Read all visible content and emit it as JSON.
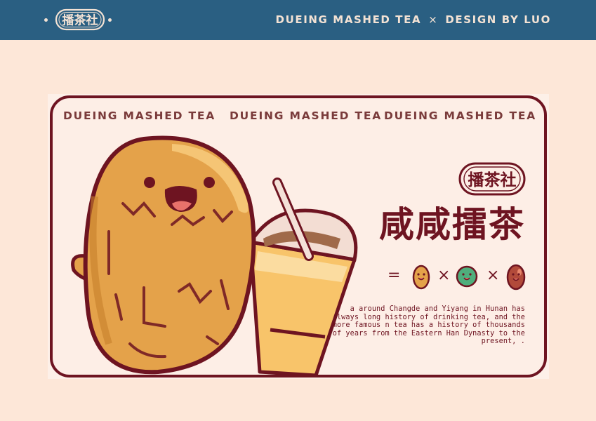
{
  "header": {
    "seal_text": "播茶社",
    "title_left": "DUEING MASHED TEA",
    "separator": "×",
    "title_right": "DESIGN BY LUO"
  },
  "card": {
    "marquee": [
      "DUEING MASHED TEA",
      "DUEING MASHED TEA",
      "DUEING MASHED TEA"
    ],
    "seal_text": "播茶社",
    "headline": "咸咸擂茶",
    "formula": {
      "equals": "=",
      "times": "×"
    },
    "description": "a around Changde and Yiyang in Hunan has always long history of drinking tea, and the more famous n tea has a history of thousands of years from the Eastern Han Dynasty to the present, ."
  },
  "colors": {
    "topbar": "#2a5f82",
    "page": "#fde7d8",
    "maroon": "#6e1421",
    "peanut": "#e4a24a",
    "cup": "#f8c46a"
  }
}
